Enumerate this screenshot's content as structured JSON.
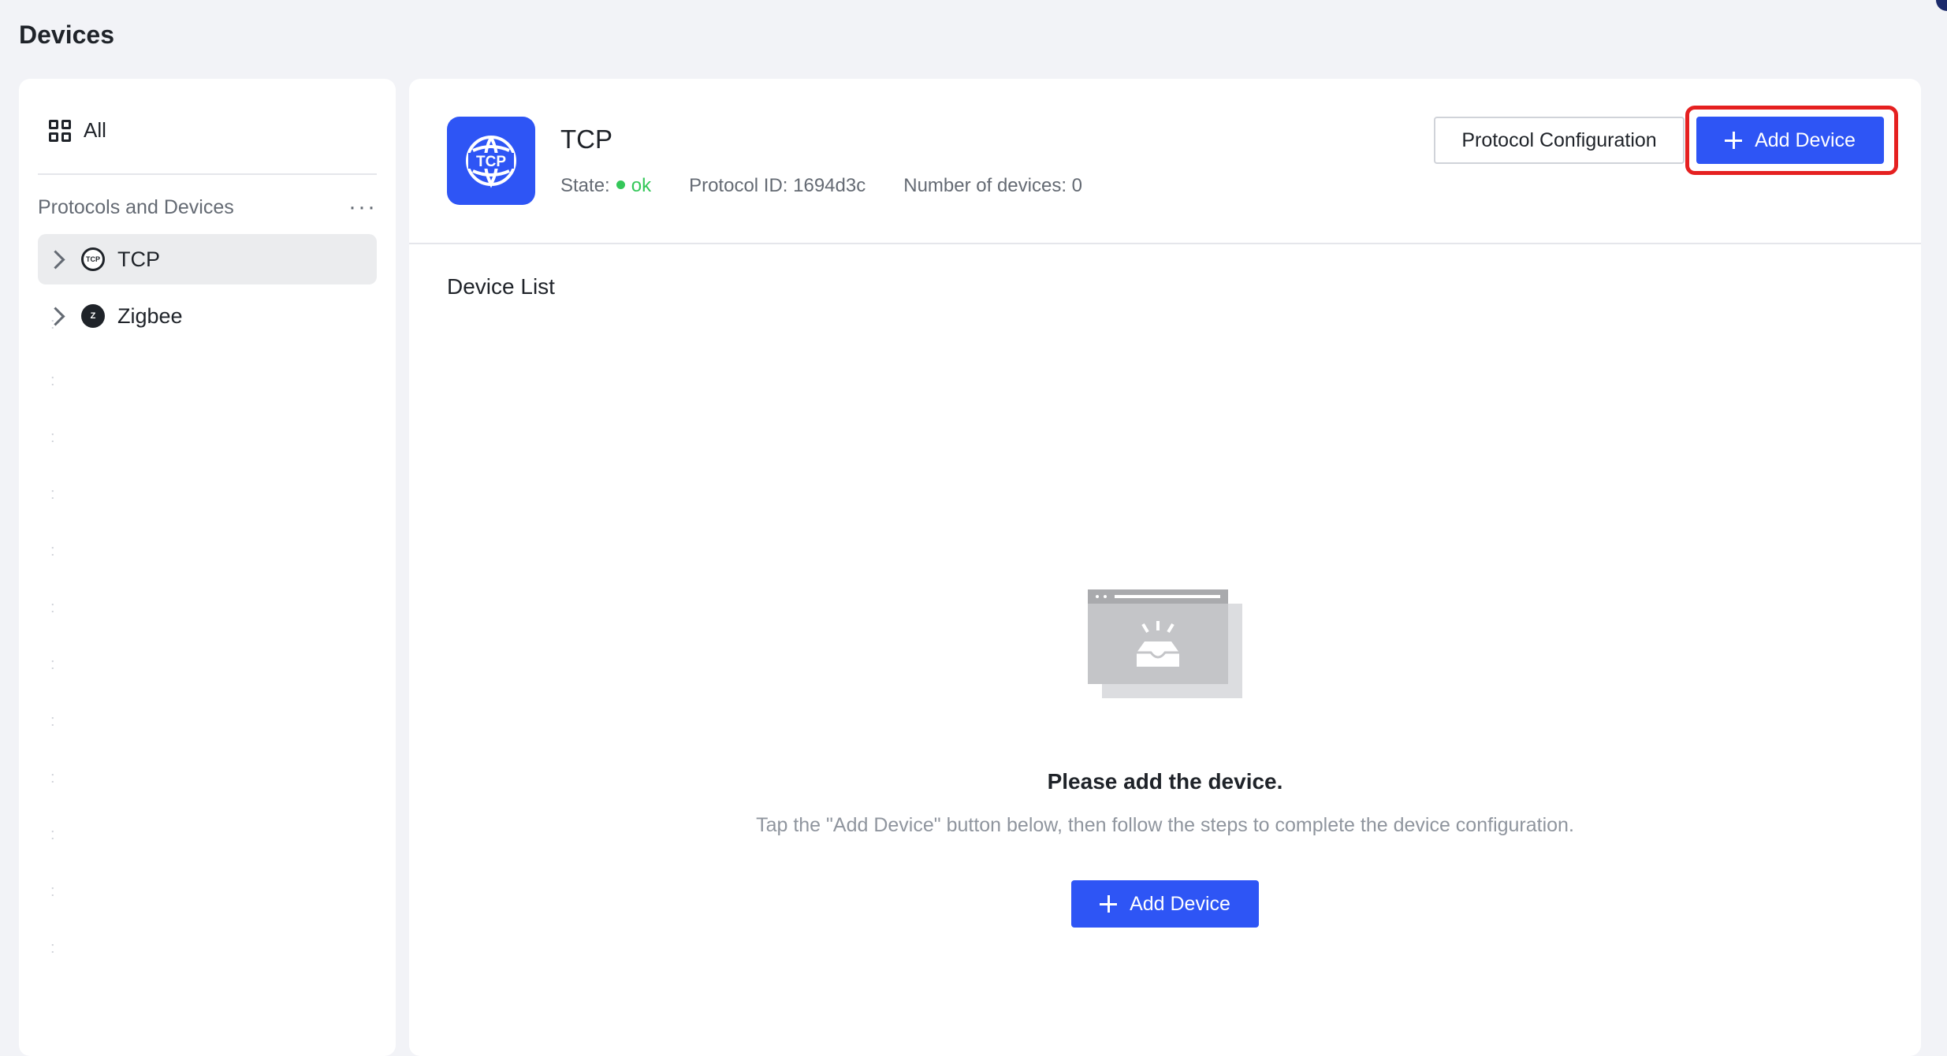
{
  "page": {
    "title": "Devices"
  },
  "sidebar": {
    "all_label": "All",
    "section_title": "Protocols and Devices",
    "more_label": "···",
    "items": [
      {
        "label": "TCP",
        "icon": "tcp-globe-icon",
        "active": true
      },
      {
        "label": "Zigbee",
        "icon": "zigbee-icon",
        "active": false
      }
    ]
  },
  "protocol": {
    "logo_text": "TCP",
    "name": "TCP",
    "state_label": "State:",
    "state_value": "ok",
    "id_label": "Protocol ID:",
    "id_value": "1694d3c",
    "count_label": "Number of devices:",
    "count_value": "0"
  },
  "actions": {
    "protocol_config_label": "Protocol Configuration",
    "add_device_label": "Add Device"
  },
  "device_list": {
    "title": "Device List",
    "empty_title": "Please add the device.",
    "empty_desc": "Tap the \"Add Device\" button below, then follow the steps to complete the device configuration.",
    "add_device_label": "Add Device"
  },
  "colors": {
    "primary": "#2e55f5",
    "ok": "#34c759",
    "highlight": "#e52020"
  }
}
